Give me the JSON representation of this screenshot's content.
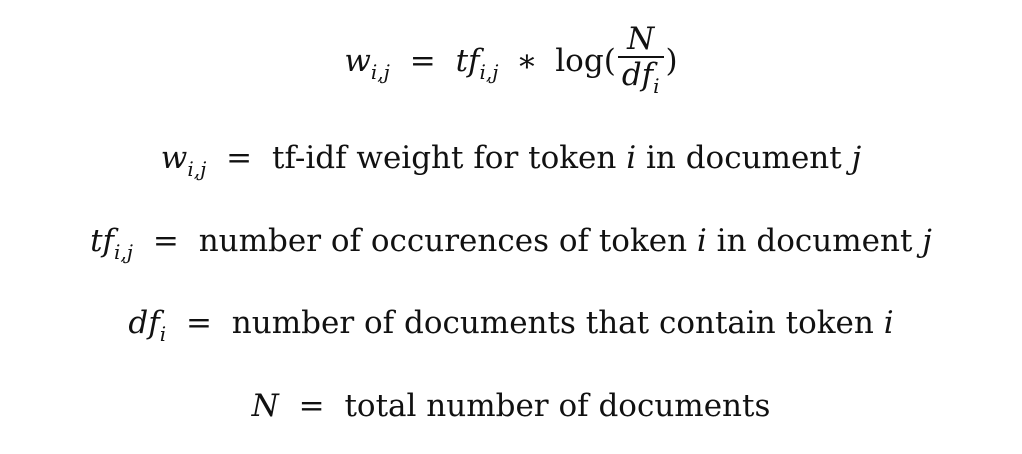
{
  "formula": {
    "lhs_symbol": "w",
    "lhs_sub": "i,j",
    "equals": "=",
    "tf_symbol": "tf",
    "tf_sub": "i,j",
    "multiply": "∗",
    "log": "log",
    "open_paren": "(",
    "numerator": "N",
    "denominator_symbol": "df",
    "denominator_sub": "i",
    "close_paren": ")"
  },
  "definitions": [
    {
      "symbol": "w",
      "sub": "i,j",
      "equals": "=",
      "text_parts": [
        "tf-idf weight for token ",
        "i",
        " in document ",
        "j"
      ]
    },
    {
      "symbol": "tf",
      "sub": "i,j",
      "equals": "=",
      "text_parts": [
        "number of occurences of token ",
        "i",
        " in document ",
        "j"
      ]
    },
    {
      "symbol": "df",
      "sub": "i",
      "equals": "=",
      "text_parts": [
        "number of documents that contain token ",
        "i"
      ]
    },
    {
      "symbol": "N",
      "sub": "",
      "equals": "=",
      "text_parts": [
        "total number of documents"
      ]
    }
  ]
}
